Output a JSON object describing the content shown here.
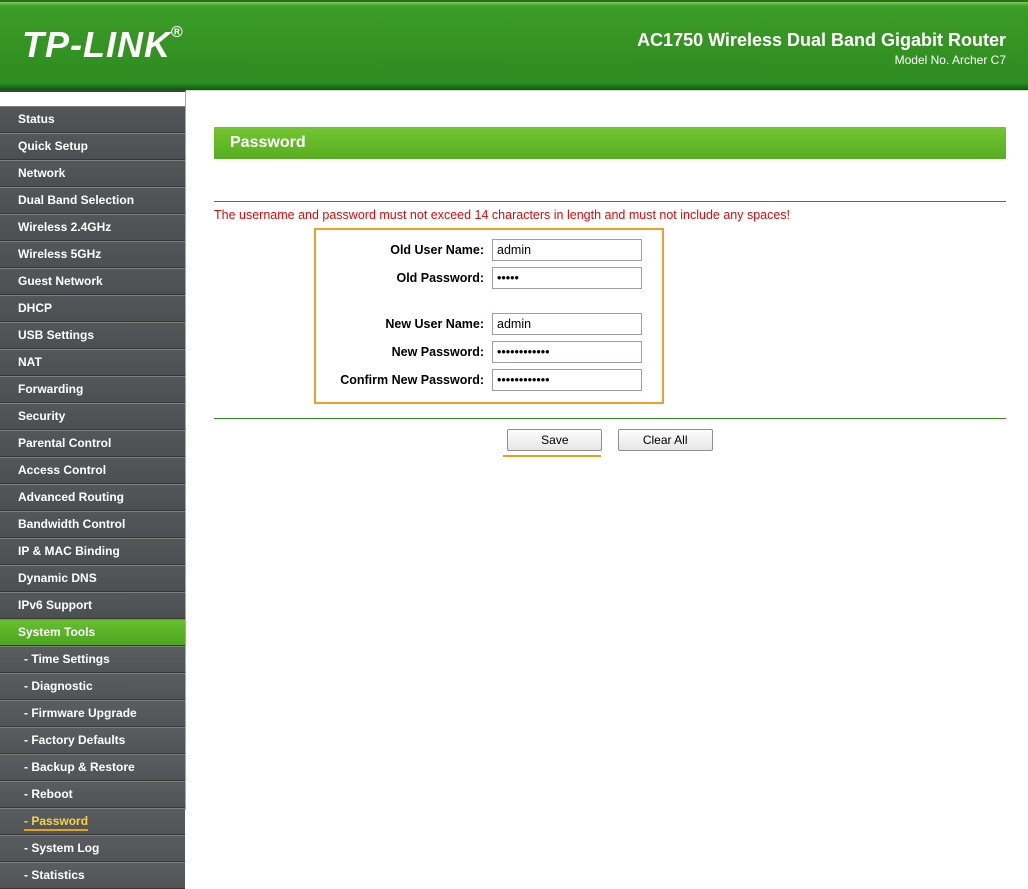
{
  "header": {
    "brand": "TP-LINK",
    "reg": "®",
    "product_line1": "AC1750 Wireless Dual Band Gigabit Router",
    "product_line2": "Model No. Archer C7"
  },
  "sidebar": {
    "items": [
      {
        "label": "Status",
        "type": "top"
      },
      {
        "label": "Quick Setup",
        "type": "top"
      },
      {
        "label": "Network",
        "type": "top"
      },
      {
        "label": "Dual Band Selection",
        "type": "top"
      },
      {
        "label": "Wireless 2.4GHz",
        "type": "top"
      },
      {
        "label": "Wireless 5GHz",
        "type": "top"
      },
      {
        "label": "Guest Network",
        "type": "top"
      },
      {
        "label": "DHCP",
        "type": "top"
      },
      {
        "label": "USB Settings",
        "type": "top"
      },
      {
        "label": "NAT",
        "type": "top"
      },
      {
        "label": "Forwarding",
        "type": "top"
      },
      {
        "label": "Security",
        "type": "top"
      },
      {
        "label": "Parental Control",
        "type": "top"
      },
      {
        "label": "Access Control",
        "type": "top"
      },
      {
        "label": "Advanced Routing",
        "type": "top"
      },
      {
        "label": "Bandwidth Control",
        "type": "top"
      },
      {
        "label": "IP & MAC Binding",
        "type": "top"
      },
      {
        "label": "Dynamic DNS",
        "type": "top"
      },
      {
        "label": "IPv6 Support",
        "type": "top"
      },
      {
        "label": "System Tools",
        "type": "top",
        "active": true
      },
      {
        "label": "- Time Settings",
        "type": "sub"
      },
      {
        "label": "- Diagnostic",
        "type": "sub"
      },
      {
        "label": "- Firmware Upgrade",
        "type": "sub"
      },
      {
        "label": "- Factory Defaults",
        "type": "sub"
      },
      {
        "label": "- Backup & Restore",
        "type": "sub"
      },
      {
        "label": "- Reboot",
        "type": "sub"
      },
      {
        "label": "- Password",
        "type": "sub",
        "current": true
      },
      {
        "label": "- System Log",
        "type": "sub"
      },
      {
        "label": "- Statistics",
        "type": "sub"
      }
    ]
  },
  "page": {
    "title": "Password",
    "warning": "The username and password must not exceed 14 characters in length and must not include any spaces!",
    "labels": {
      "old_user": "Old User Name:",
      "old_pass": "Old Password:",
      "new_user": "New User Name:",
      "new_pass": "New Password:",
      "confirm_pass": "Confirm New Password:"
    },
    "values": {
      "old_user": "admin",
      "old_pass": "•••••",
      "new_user": "admin",
      "new_pass": "••••••••••••",
      "confirm_pass": "••••••••••••"
    },
    "buttons": {
      "save": "Save",
      "clear": "Clear All"
    }
  }
}
